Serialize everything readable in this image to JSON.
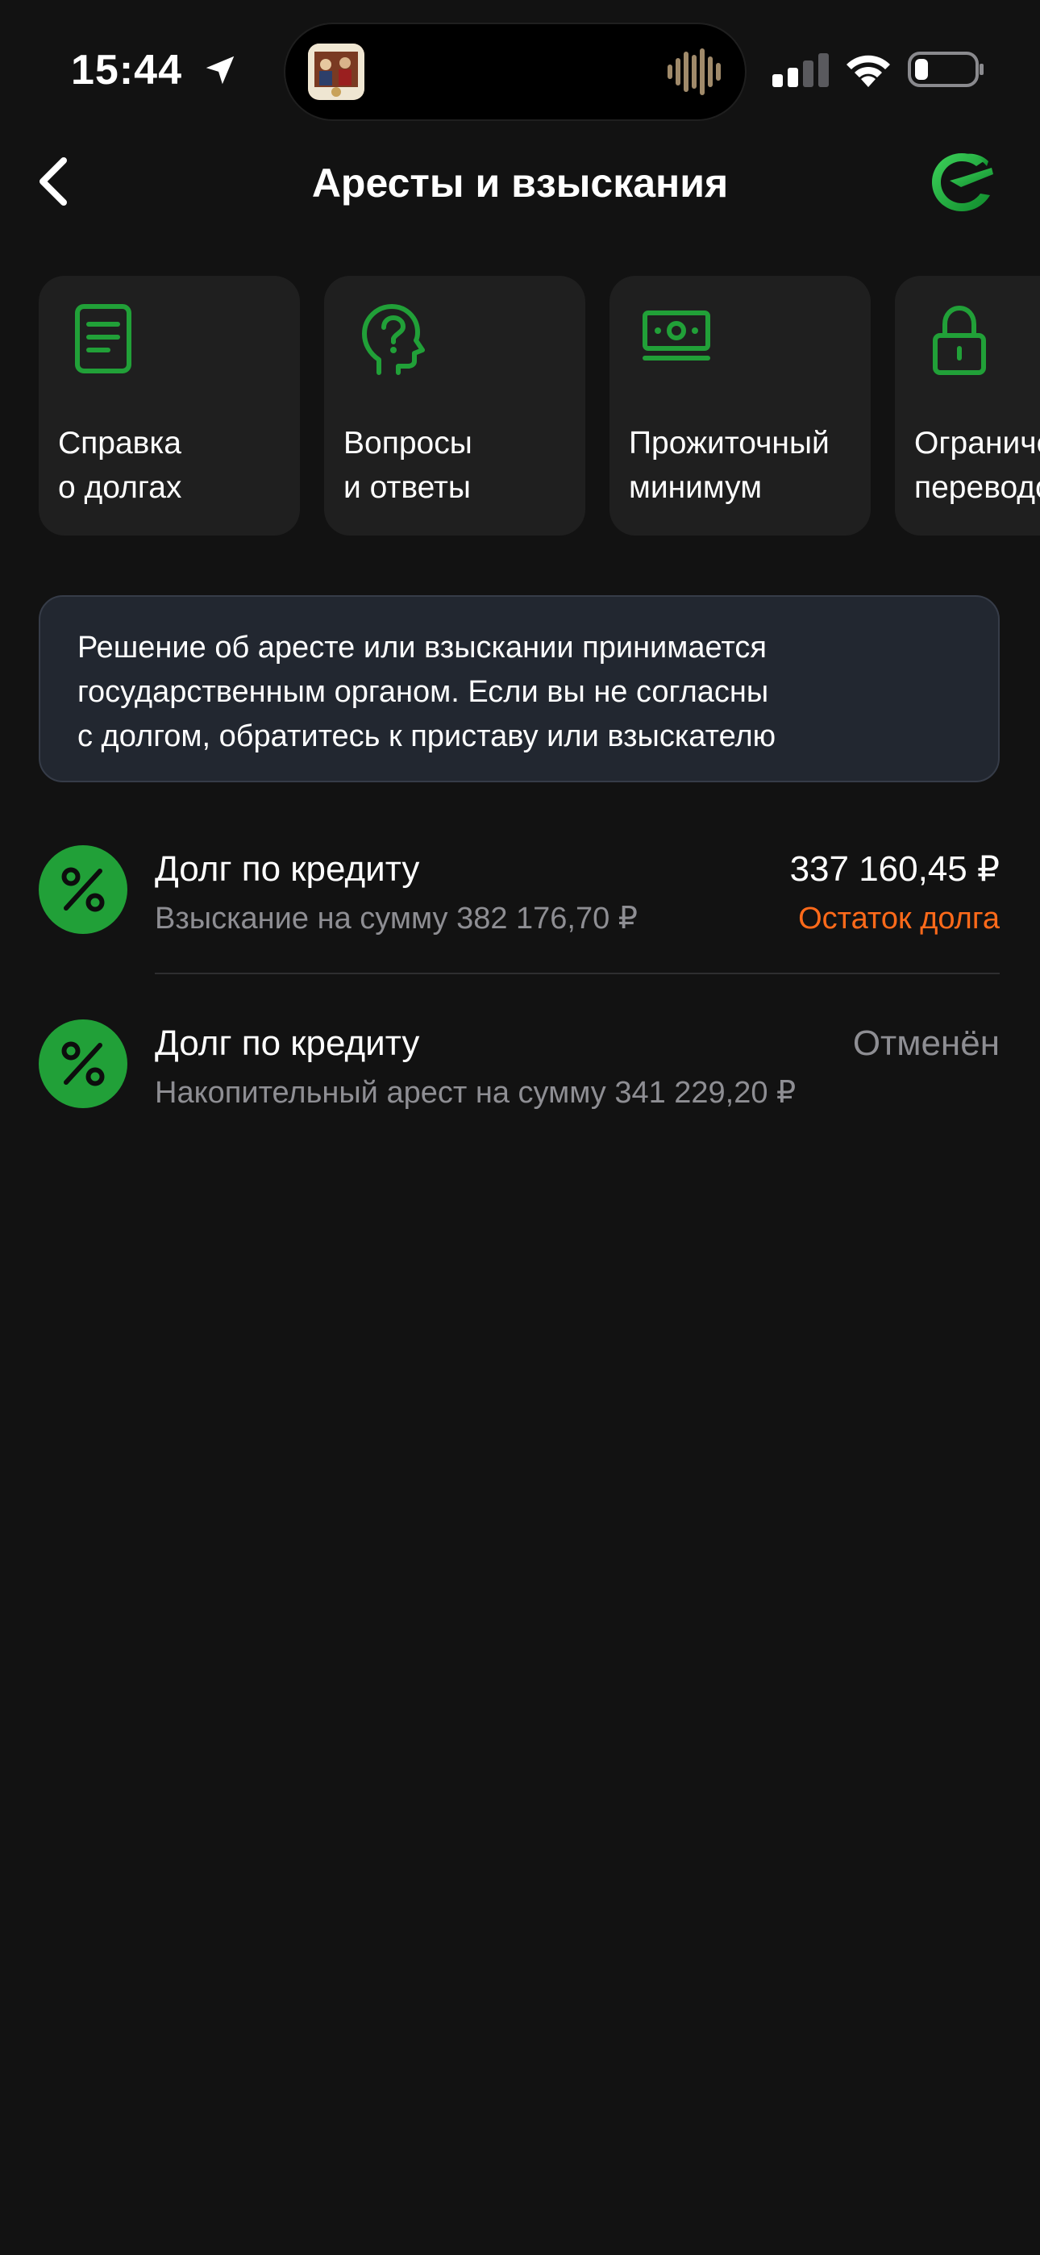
{
  "status_bar": {
    "time": "15:44",
    "icons": [
      "location-arrow-icon",
      "album-artwork-icon",
      "audio-wave-icon",
      "cellular-signal-icon",
      "wifi-icon",
      "battery-icon"
    ]
  },
  "nav": {
    "back_icon": "chevron-left-icon",
    "title": "Аресты и взыскания",
    "logo_icon": "sber-logo-icon"
  },
  "quick_actions": [
    {
      "label": "Справка\nо долгах",
      "icon": "document-icon"
    },
    {
      "label": "Вопросы\nи ответы",
      "icon": "head-question-icon"
    },
    {
      "label": "Прожиточный\nминимум",
      "icon": "banknote-icon"
    },
    {
      "label": "Ограничения\nпереводов",
      "icon": "lock-icon"
    }
  ],
  "notice": {
    "text": "Решение об аресте или взыскании принимается\nгосударственным органом. Если вы не согласны\nс долгом, обратитесь к приставу или взыскателю"
  },
  "debts": [
    {
      "icon": "percent-icon",
      "title": "Долг по кредиту",
      "subtitle": "Взыскание на сумму 382 176,70 ₽",
      "amount": "337 160,45 ₽",
      "status": "Остаток долга",
      "status_color": "#ff6a1a"
    },
    {
      "icon": "percent-icon",
      "title": "Долг по кредиту",
      "subtitle": "Накопительный арест на сумму 341 229,20 ₽",
      "amount": "",
      "status": "Отменён",
      "status_color": "#8e8e93"
    }
  ],
  "colors": {
    "background": "#121212",
    "accent_green": "#21a038",
    "tile_background": "#1f1f1f",
    "notice_background": "#222730",
    "warning_orange": "#ff6a1a",
    "secondary_text": "#8e8e93"
  }
}
